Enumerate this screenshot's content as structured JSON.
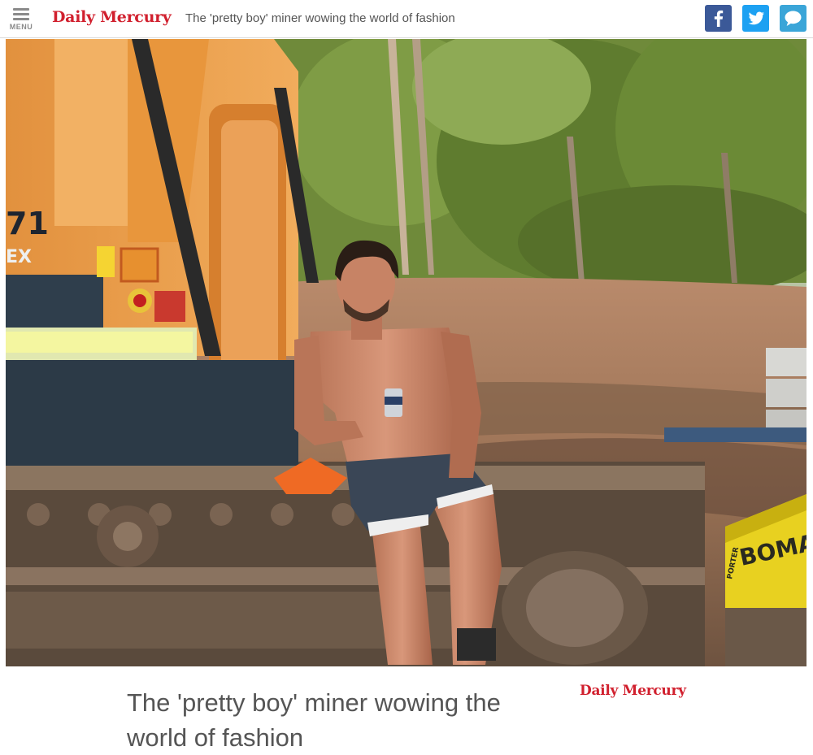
{
  "header": {
    "menu_label": "MENU",
    "brand": "Daily Mercury",
    "headline": "The 'pretty boy' miner wowing the world of fashion",
    "share": {
      "facebook_icon": "facebook-icon",
      "twitter_icon": "twitter-icon",
      "comment_icon": "comment-icon",
      "facebook_color": "#3b5998",
      "twitter_color": "#1da1f2",
      "comment_color": "#3aa5d8"
    }
  },
  "hero": {
    "machine_number": "71",
    "machine_model": "EX",
    "roller_brand": "BOMAG",
    "roller_side_text": "PORTER"
  },
  "article": {
    "title": "The 'pretty boy' miner wowing the world of fashion",
    "source": "Daily Mercury"
  },
  "colors": {
    "brand_red": "#d1202e",
    "text_gray": "#555555"
  }
}
